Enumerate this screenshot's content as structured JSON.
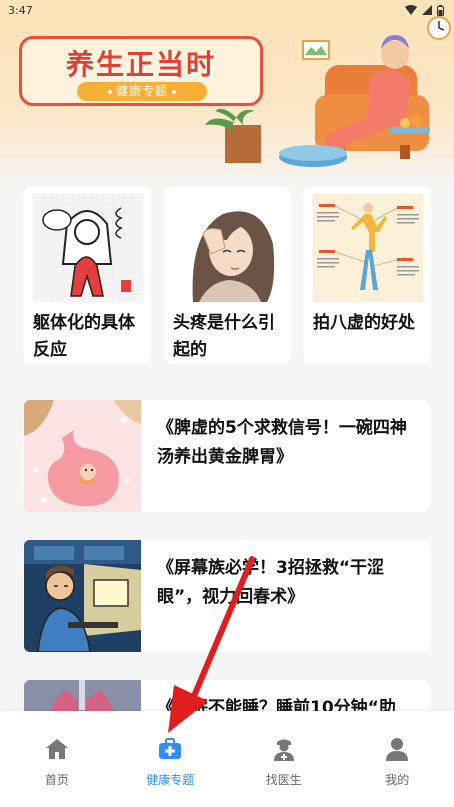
{
  "status_bar": {
    "time": "3:47"
  },
  "banner": {
    "title": "养生正当时",
    "subtitle": "健康专题"
  },
  "cards": [
    {
      "title": "躯体化的具体反应",
      "icon": "figure-hugging-knees-image"
    },
    {
      "title": "头疼是什么引起的",
      "icon": "woman-headache-image"
    },
    {
      "title": "拍八虚的好处",
      "icon": "body-points-diagram-image"
    }
  ],
  "articles": [
    {
      "title": "《脾虚的5个求救信号！一碗四神汤养出黄金脾胃》",
      "icon": "stomach-cartoon-image"
    },
    {
      "title": "《屏幕族必学！3招拯救“干涩眼”，视力回春术》",
      "icon": "screen-worker-image"
    },
    {
      "title": "《失眠不能睡？睡前10分钟“助",
      "icon": "lungs-image"
    }
  ],
  "tabs": [
    {
      "label": "首页",
      "icon": "home-icon",
      "active": false
    },
    {
      "label": "健康专题",
      "icon": "medical-kit-icon",
      "active": true
    },
    {
      "label": "找医生",
      "icon": "doctor-icon",
      "active": false
    },
    {
      "label": "我的",
      "icon": "person-icon",
      "active": false
    }
  ],
  "colors": {
    "accent": "#2d8ff2",
    "banner_red": "#e5402d",
    "banner_orange": "#f7b035",
    "arrow_red": "#e11d1d"
  }
}
